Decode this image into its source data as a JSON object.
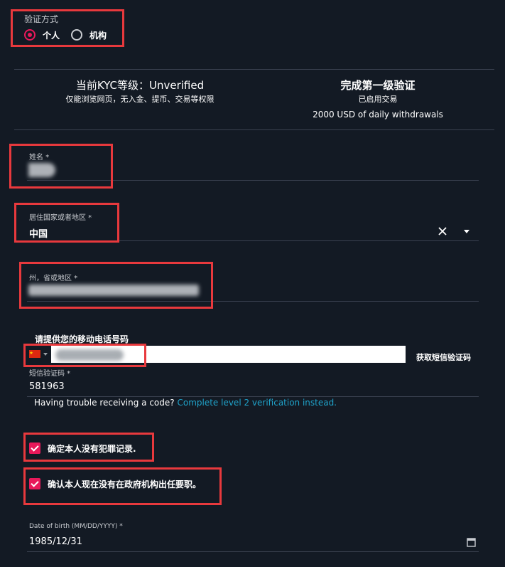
{
  "verification": {
    "title": "验证方式",
    "options": [
      {
        "label": "个人",
        "selected": true
      },
      {
        "label": "机构",
        "selected": false
      }
    ]
  },
  "kyc": {
    "current_title": "当前KYC等级：Unverified",
    "current_desc": "仅能浏览网页，无入金、提币、交易等权限",
    "next_title": "完成第一级验证",
    "next_line1": "已启用交易",
    "next_line2": "2000 USD of daily withdrawals"
  },
  "form": {
    "name_label": "姓名 *",
    "country_label": "居住国家或者地区 *",
    "country_value": "中国",
    "region_label": "州，省或地区 *",
    "phone_prompt": "请提供您的移动电话号码",
    "get_code_button": "获取短信验证码",
    "sms_label": "短信验证码 *",
    "sms_value": "581963",
    "trouble_text": "Having trouble receiving a code?",
    "trouble_link": "Complete level 2 verification instead.",
    "checkbox1": "确定本人没有犯罪记录.",
    "checkbox2": "确认本人现在没有在政府机构出任要职。",
    "dob_label": "Date of birth (MM/DD/YYYY) *",
    "dob_value": "1985/12/31"
  },
  "colors": {
    "background": "#131a24",
    "accent": "#e8195a",
    "highlight_box": "#e8393d",
    "link": "#1fa2c9"
  },
  "icons": {
    "clear": "close-icon",
    "dropdown": "caret-down-icon",
    "flag": "china-flag-icon",
    "calendar": "calendar-icon"
  }
}
